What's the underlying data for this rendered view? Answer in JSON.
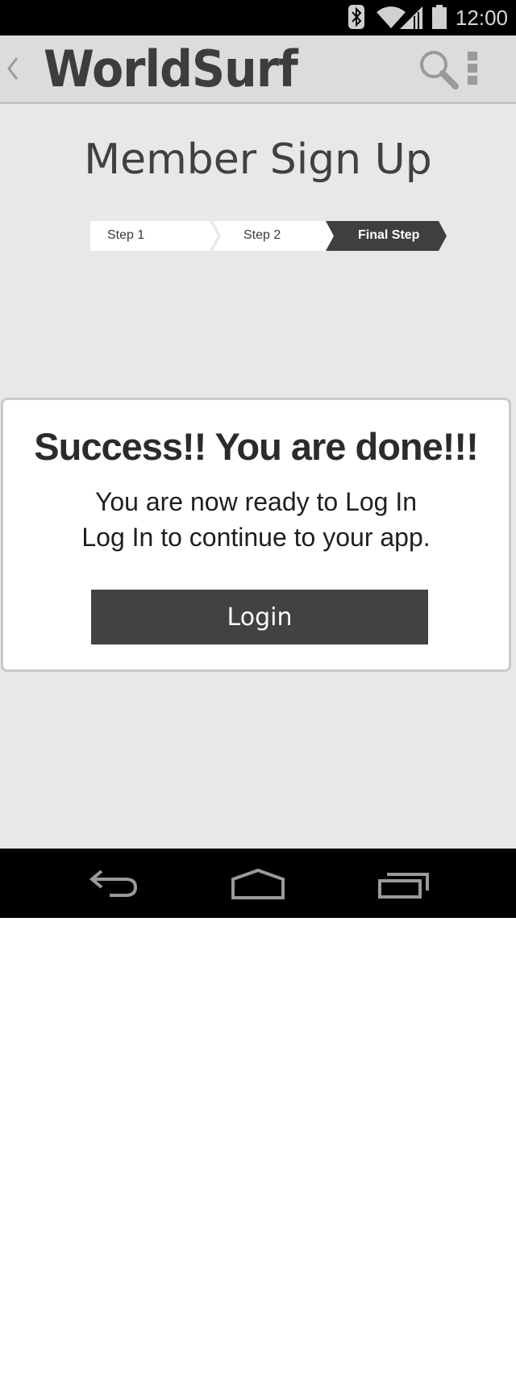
{
  "status_bar": {
    "time": "12:00",
    "icons": [
      "bluetooth-icon",
      "wifi-icon",
      "signal-icon",
      "battery-icon"
    ]
  },
  "action_bar": {
    "app_title": "WorldSurf",
    "icons": [
      "back-caret-icon",
      "search-icon",
      "overflow-menu-icon"
    ]
  },
  "page": {
    "title": "Member Sign Up"
  },
  "stepper": {
    "steps": [
      {
        "label": "Step 1",
        "active": false
      },
      {
        "label": "Step 2",
        "active": false
      },
      {
        "label": "Final Step",
        "active": true
      }
    ]
  },
  "success_card": {
    "title": "Success!! You are done!!!",
    "message_line1": "You are now ready to Log In",
    "message_line2": "Log In to continue to your app.",
    "login_label": "Login"
  },
  "nav_bar": {
    "icons": [
      "back-nav-icon",
      "home-nav-icon",
      "recents-nav-icon"
    ]
  },
  "colors": {
    "background": "#e8e8e8",
    "action_bar": "#dcdcdc",
    "dark_accent": "#424244",
    "status_bar": "#000000"
  }
}
